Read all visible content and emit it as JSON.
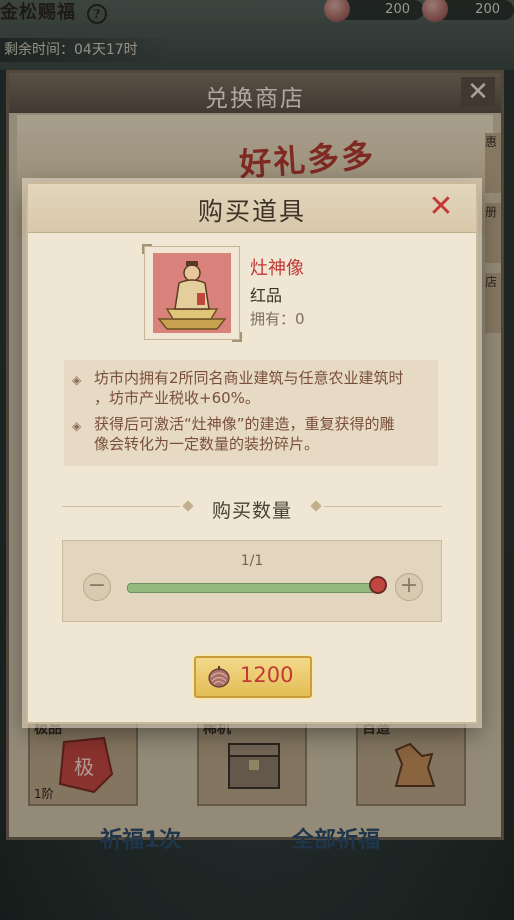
{
  "event": {
    "title": "金松赐福",
    "help_icon": "help-icon"
  },
  "resources": [
    {
      "icon": "pinecone-icon",
      "value": "200"
    },
    {
      "icon": "pinecone-icon",
      "value": "200"
    }
  ],
  "timer": {
    "text": "剩余时间：04天17时"
  },
  "shop": {
    "title": "兑换商店",
    "close_icon": "close-icon",
    "banner_text": "好礼多多",
    "side_tabs": [
      "惠",
      "册",
      "店"
    ],
    "cards": [
      {
        "label": "极品",
        "sub": "1阶"
      },
      {
        "label": "稀机",
        "sub": ""
      },
      {
        "label": "百造",
        "sub": ""
      }
    ],
    "buttons": [
      "祈福1次",
      "全部祈福"
    ]
  },
  "modal": {
    "title": "购买道具",
    "item": {
      "name": "灶神像",
      "grade": "红品",
      "owned": "拥有：0"
    },
    "description": [
      {
        "lines": [
          "坊市内拥有2所同名商业建筑与任意农业建筑时",
          "，坊市产业税收+60%。"
        ]
      },
      {
        "lines": [
          "获得后可激活“灶神像”的建造，重复获得的雕",
          "像会转化为一定数量的装扮碎片。"
        ]
      }
    ],
    "quantity": {
      "label": "购买数量",
      "count": "1/1",
      "minus": "−",
      "plus": "+",
      "fill_fraction": 1.0
    },
    "buy": {
      "price": "1200",
      "currency_icon": "pinecone-icon"
    }
  },
  "colors": {
    "accent_red": "#c03a35",
    "slider_green": "#93b97f",
    "gold": "#e3bd55"
  }
}
